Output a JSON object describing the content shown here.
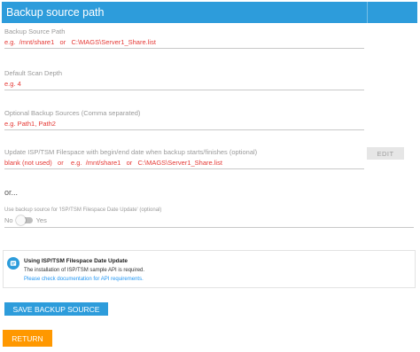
{
  "header": {
    "title": "Backup source path"
  },
  "fields": {
    "path": {
      "label": "Backup Source Path",
      "placeholder": "e.g.  /mnt/share1   or   C:\\MAGS\\Server1_Share.list"
    },
    "depth": {
      "label": "Default Scan Depth",
      "placeholder": "e.g. 4"
    },
    "optional": {
      "label": "Optional Backup Sources (Comma separated)",
      "placeholder": "e.g. Path1, Path2"
    },
    "filespace": {
      "label": "Update ISP/TSM Filespace with begin/end date when backup starts/finishes (optional)",
      "placeholder": "blank (not used)   or    e.g.  /mnt/share1   or   C:\\MAGS\\Server1_Share.list"
    }
  },
  "edit_button": {
    "label": "EDIT"
  },
  "or_text": "or...",
  "toggle": {
    "label": "Use backup source for 'ISP/TSM Filespace Date Update' (optional)",
    "off_label": "No",
    "on_label": "Yes",
    "checked": false
  },
  "info": {
    "title": "Using ISP/TSM Filespace Date Update",
    "body": "The installation of ISP/TSM sample API is required.",
    "link": "Please check documentation for API requirements."
  },
  "buttons": {
    "save": "SAVE BACKUP SOURCE",
    "return": "RETURN"
  },
  "colors": {
    "primary": "#2d9cdb",
    "accent": "#ff9800",
    "placeholder_red": "#e53935"
  }
}
